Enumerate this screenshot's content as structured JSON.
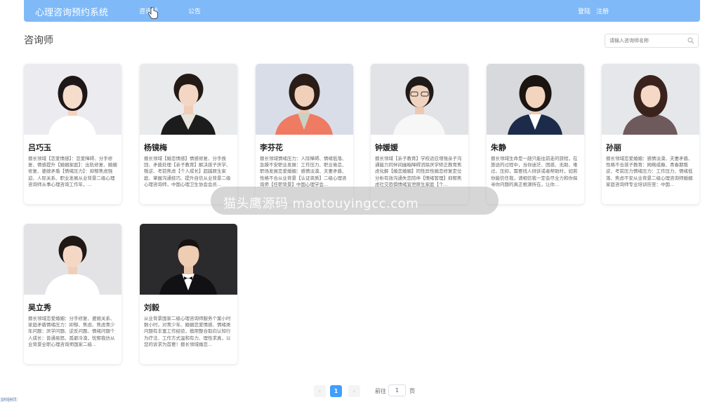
{
  "header": {
    "app_title": "心理咨询预约系统",
    "nav": [
      "咨询师",
      "公告"
    ],
    "auth": {
      "login": "登陆",
      "register": "注册"
    }
  },
  "page": {
    "title": "咨询师",
    "search_placeholder": "请输入咨询师名称"
  },
  "counselors": [
    {
      "name": "吕巧玉",
      "desc": "擅长领域【恋爱情感】：恋爱障碍、分手修复、情感提升【婚姻家庭】：出轨修复、婚姻修复、婆媳矛盾【情绪压力】：抑郁焦虑强迫、人际关系、职业发展从业背景二级心理咨询师从事心理咨询工作年，..."
    },
    {
      "name": "杨镜梅",
      "desc": "擅长领域【婚恋情感】情感修复、分手挽回、矛盾处理【亲子教育】解决孩子厌学、叛逆、考前焦虑【个人成长】超越原生家庭、掌握沟通技巧、提升自信从业背景二级心理咨询师，中国心理卫生协会会员..."
    },
    {
      "name": "李芬花",
      "desc": "擅长领域情绪压力：人际障碍、情绪低落、急躁不安职业发展：工作压力、职业倦怠、职场发展恋爱婚姻：感情淡漠、夫妻矛盾、性格不合从业背景【认证资质】二级心理咨询师【任职背景】中国心理学会..."
    },
    {
      "name": "钟媛媛",
      "desc": "擅长领域【亲子教育】学校适应增强亲子沟通能力同伴间幽暗障碍消除厌学矫正教育焦虑化解【婚恋婚姻】同性异性婚恋修复定位分析有效沟通失恋陪伴【情绪管理】抑郁焦虑社交恐惧情绪宣泄原生家庭【个..."
    },
    {
      "name": "朱静",
      "desc": "擅长领域生命是一趟只能往前走的旅程，在旅途的过程中，当你迷茫、困惑、无助、难过、压抑，需要找人倾诉或者帮助时，如若你能信任我，请相信我一定会尽全力和你探寻你问题的真正根源所在，让你..."
    },
    {
      "name": "孙丽",
      "desc": "擅长领域恋爱婚姻：感情淡漠、夫妻矛盾、性格不合孩子教育：网络成瘾、青春期叛逆、考前压力情绪压力：工作压力、情绪低落、焦虑不安从业背景二级心理咨询师婚姻家庭咨询师专业培训历至：中国..."
    },
    {
      "name": "吴立秀",
      "desc": "擅长领域恋爱婚姻：分手修复、婆媳关系、家庭矛盾情绪压力：抑郁、焦虑、焦虑青少年问题：厌学问题、逆反问题、情绪问题个人成长：普通易怒、孤僻冷漠，忧郁我仿从业背景全职心理咨询师国家二级..."
    },
    {
      "name": "刘毅",
      "desc": "从业背景国家二级心理咨询师服务个案小时数小时，对青少年、婚姻恋爱情感、情绪类问题有丰富工作经验，擅用整合取向认知行为疗法、工作方式温和有力、理性求真，以您的诉求为首要！擅长领域婚恋..."
    }
  ],
  "watermark": "猫头鹰源码 maotouyingcc.com",
  "pagination": {
    "prev": "‹",
    "current": "1",
    "next": "›",
    "goto_label": "前往",
    "goto_value": "1",
    "page_unit": "页"
  },
  "status_tag": "project",
  "colors": {
    "accent": "#409eff",
    "topbar": "#7fb9f7"
  }
}
